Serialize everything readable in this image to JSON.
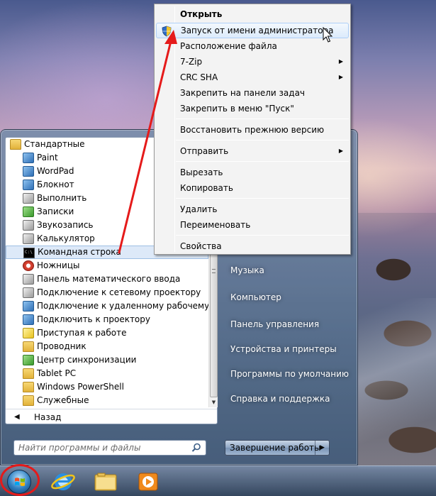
{
  "programs": {
    "folder_header": "Стандартные",
    "items": [
      {
        "label": "Paint",
        "icon": "paint-icon"
      },
      {
        "label": "WordPad",
        "icon": "wordpad-icon"
      },
      {
        "label": "Блокнот",
        "icon": "notepad-icon"
      },
      {
        "label": "Выполнить",
        "icon": "run-icon"
      },
      {
        "label": "Записки",
        "icon": "sticky-notes-icon"
      },
      {
        "label": "Звукозапись",
        "icon": "sound-recorder-icon"
      },
      {
        "label": "Калькулятор",
        "icon": "calculator-icon"
      },
      {
        "label": "Командная строка",
        "icon": "cmd-icon",
        "selected": true
      },
      {
        "label": "Ножницы",
        "icon": "snipping-tool-icon"
      },
      {
        "label": "Панель математического ввода",
        "icon": "math-input-icon"
      },
      {
        "label": "Подключение к сетевому проектору",
        "icon": "network-projector-icon"
      },
      {
        "label": "Подключение к удаленному рабочему столу",
        "icon": "remote-desktop-icon"
      },
      {
        "label": "Подключить к проектору",
        "icon": "projector-icon"
      },
      {
        "label": "Приступая к работе",
        "icon": "getting-started-icon"
      },
      {
        "label": "Проводник",
        "icon": "explorer-icon"
      },
      {
        "label": "Центр синхронизации",
        "icon": "sync-center-icon"
      },
      {
        "label": "Tablet PC",
        "icon": "folder-icon"
      },
      {
        "label": "Windows PowerShell",
        "icon": "folder-icon"
      },
      {
        "label": "Служебные",
        "icon": "folder-icon"
      }
    ],
    "back_label": "Назад"
  },
  "search": {
    "placeholder": "Найти программы и файлы"
  },
  "right_pane": {
    "items": [
      "Музыка",
      "Компьютер",
      "Панель управления",
      "Устройства и принтеры",
      "Программы по умолчанию",
      "Справка и поддержка"
    ]
  },
  "shutdown": {
    "label": "Завершение работы"
  },
  "context_menu": {
    "open": "Открыть",
    "run_as_admin": "Запуск от имени администратора",
    "file_location": "Расположение файла",
    "zip": "7-Zip",
    "crc": "CRC SHA",
    "pin_taskbar": "Закрепить на панели задач",
    "pin_start": "Закрепить в меню \"Пуск\"",
    "restore": "Восстановить прежнюю версию",
    "send_to": "Отправить",
    "cut": "Вырезать",
    "copy": "Копировать",
    "delete": "Удалить",
    "rename": "Переименовать",
    "properties": "Свойства"
  },
  "colors": {
    "highlight_red": "#e51a1a",
    "selection": "#dde9f8"
  }
}
